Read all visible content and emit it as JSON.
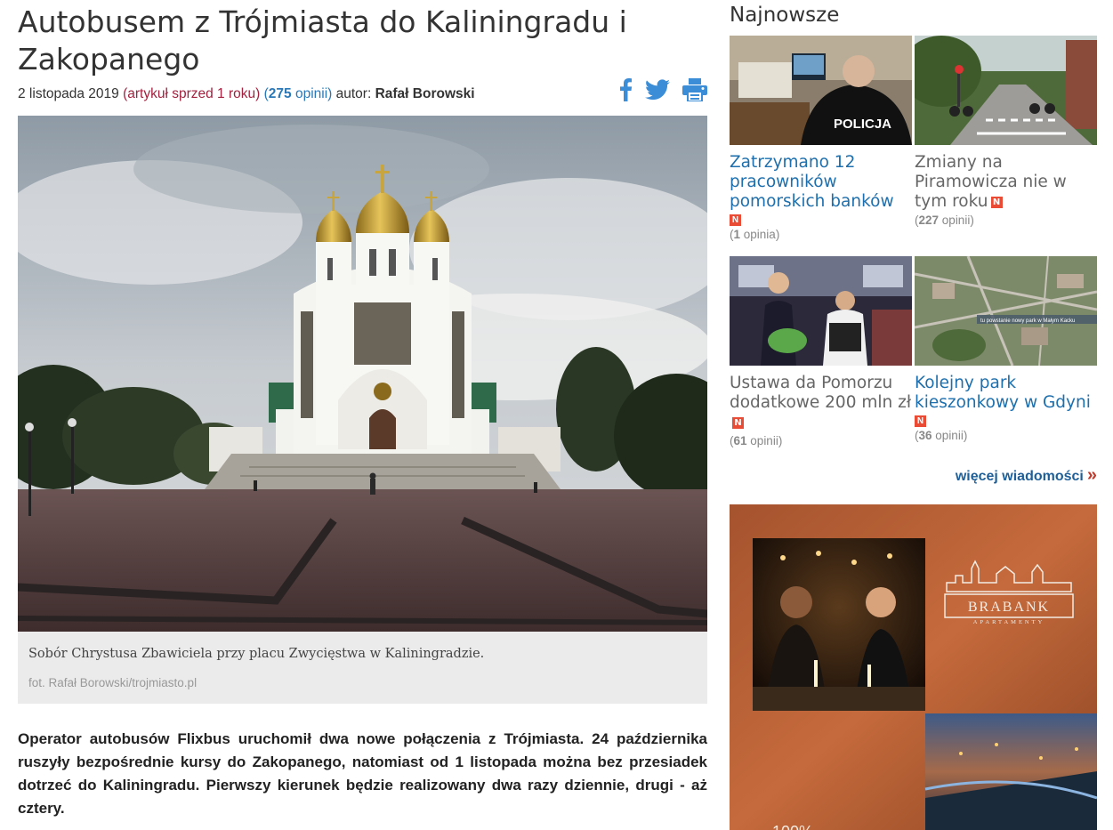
{
  "article": {
    "title": "Autobusem z Trójmiasta do Kaliningradu i Zakopanego",
    "date": "2 listopada 2019",
    "ago": "(artykuł sprzed 1 roku)",
    "opinions_open": "(",
    "opinions_count": "275",
    "opinions_label": " opinii)",
    "author_label": "autor:",
    "author": "Rafał Borowski",
    "caption": "Sobór Chrystusa Zbawiciela przy placu Zwycięstwa w Kaliningradzie.",
    "photo_source": "fot. Rafał Borowski/trojmiasto.pl",
    "lead": "Operator autobusów Flixbus uruchomił dwa nowe połączenia z Trójmiasta. 24 października ruszyły bezpośrednie kursy do Zakopanego, natomiast od 1 listopada można bez przesiadek dotrzeć do Kaliningradu. Pierwszy kierunek będzie realizowany dwa razy dziennie, drugi - aż cztery."
  },
  "share": {
    "facebook": "facebook-icon",
    "twitter": "twitter-icon",
    "print": "print-icon"
  },
  "sidebar": {
    "title": "Najnowsze",
    "news": [
      {
        "title": "Zatrzymano 12 pracowników pomorskich banków",
        "badge": "N",
        "opinions_count": "1",
        "opinions_label": "opinia"
      },
      {
        "title": "Zmiany na Piramowicza nie w tym roku",
        "badge": "N",
        "opinions_count": "227",
        "opinions_label": "opinii"
      },
      {
        "title": "Ustawa da Pomorzu dodatkowe 200 mln zł",
        "badge": "N",
        "opinions_count": "61",
        "opinions_label": "opinii"
      },
      {
        "title": "Kolejny park kieszonkowy w Gdyni",
        "badge": "N",
        "opinions_count": "36",
        "opinions_label": "opinii"
      }
    ],
    "map_label": "tu powstanie nowy park w Małym Kacku",
    "police_label": "POLICJA",
    "more": "więcej wiadomości",
    "more_icon": "»"
  },
  "ad": {
    "brand": "BRABANK",
    "brand_sub": "APARTAMENTY",
    "bottom_text": "100%"
  },
  "colors": {
    "title": "#333333",
    "link_blue": "#1e6fad",
    "ago_red": "#a2223f",
    "badge": "#e94b35"
  }
}
